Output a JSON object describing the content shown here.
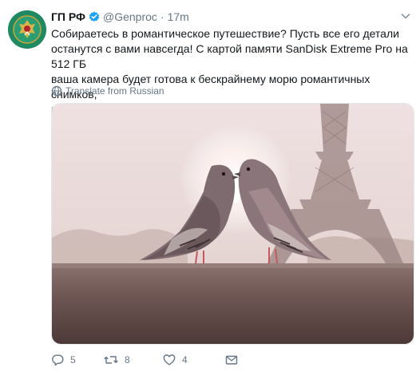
{
  "tweet": {
    "display_name": "ГП РФ",
    "handle": "@Genproc",
    "separator": "·",
    "time": "17m",
    "text": "Собираетесь в романтическое путешествие? Пусть все его детали\nостанутся с вами навсегда! С картой памяти SanDisk Extreme Pro на 512 ГБ\nваша камера будет готова к бескрайнему морю романтичных снимков,\nкоторые еще долгие годы будут греть вас воспоминаниями :)",
    "translate_label": "Translate from Russian"
  },
  "actions": {
    "reply_count": "5",
    "retweet_count": "8",
    "like_count": "4"
  },
  "icons": {
    "avatar": "prosecutor-emblem-icon",
    "verified": "verified-badge-icon",
    "chevron": "chevron-down-icon",
    "translate": "globe-icon",
    "reply": "reply-icon",
    "retweet": "retweet-icon",
    "like": "heart-icon",
    "message": "envelope-icon"
  },
  "colors": {
    "accent": "#1da1f2",
    "secondary_text": "#657786",
    "primary_text": "#14171a",
    "avatar_bg": "#1f8a62"
  }
}
